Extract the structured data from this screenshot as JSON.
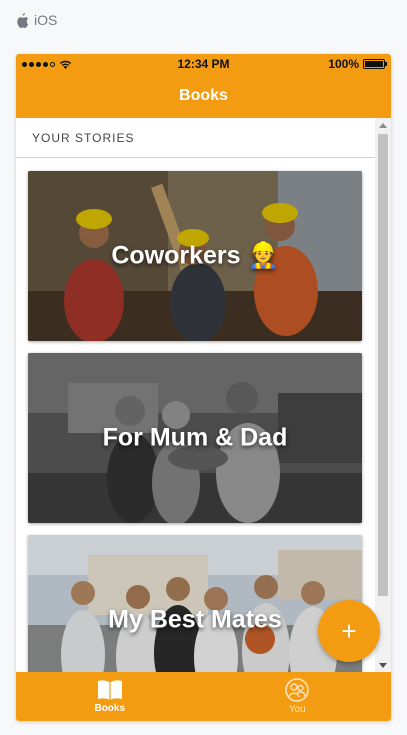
{
  "platform": {
    "label": "iOS"
  },
  "status_bar": {
    "time": "12:34 PM",
    "battery": "100%"
  },
  "nav": {
    "title": "Books"
  },
  "section": {
    "header": "YOUR STORIES"
  },
  "stories": [
    {
      "title": "Coworkers 👷"
    },
    {
      "title": "For Mum & Dad"
    },
    {
      "title": "My Best Mates"
    }
  ],
  "fab": {
    "label": "+"
  },
  "tabs": [
    {
      "label": "Books",
      "icon": "book-icon",
      "active": true
    },
    {
      "label": "You",
      "icon": "people-icon",
      "active": false
    }
  ],
  "colors": {
    "accent": "#f39c12",
    "background": "#f7f8fa"
  }
}
